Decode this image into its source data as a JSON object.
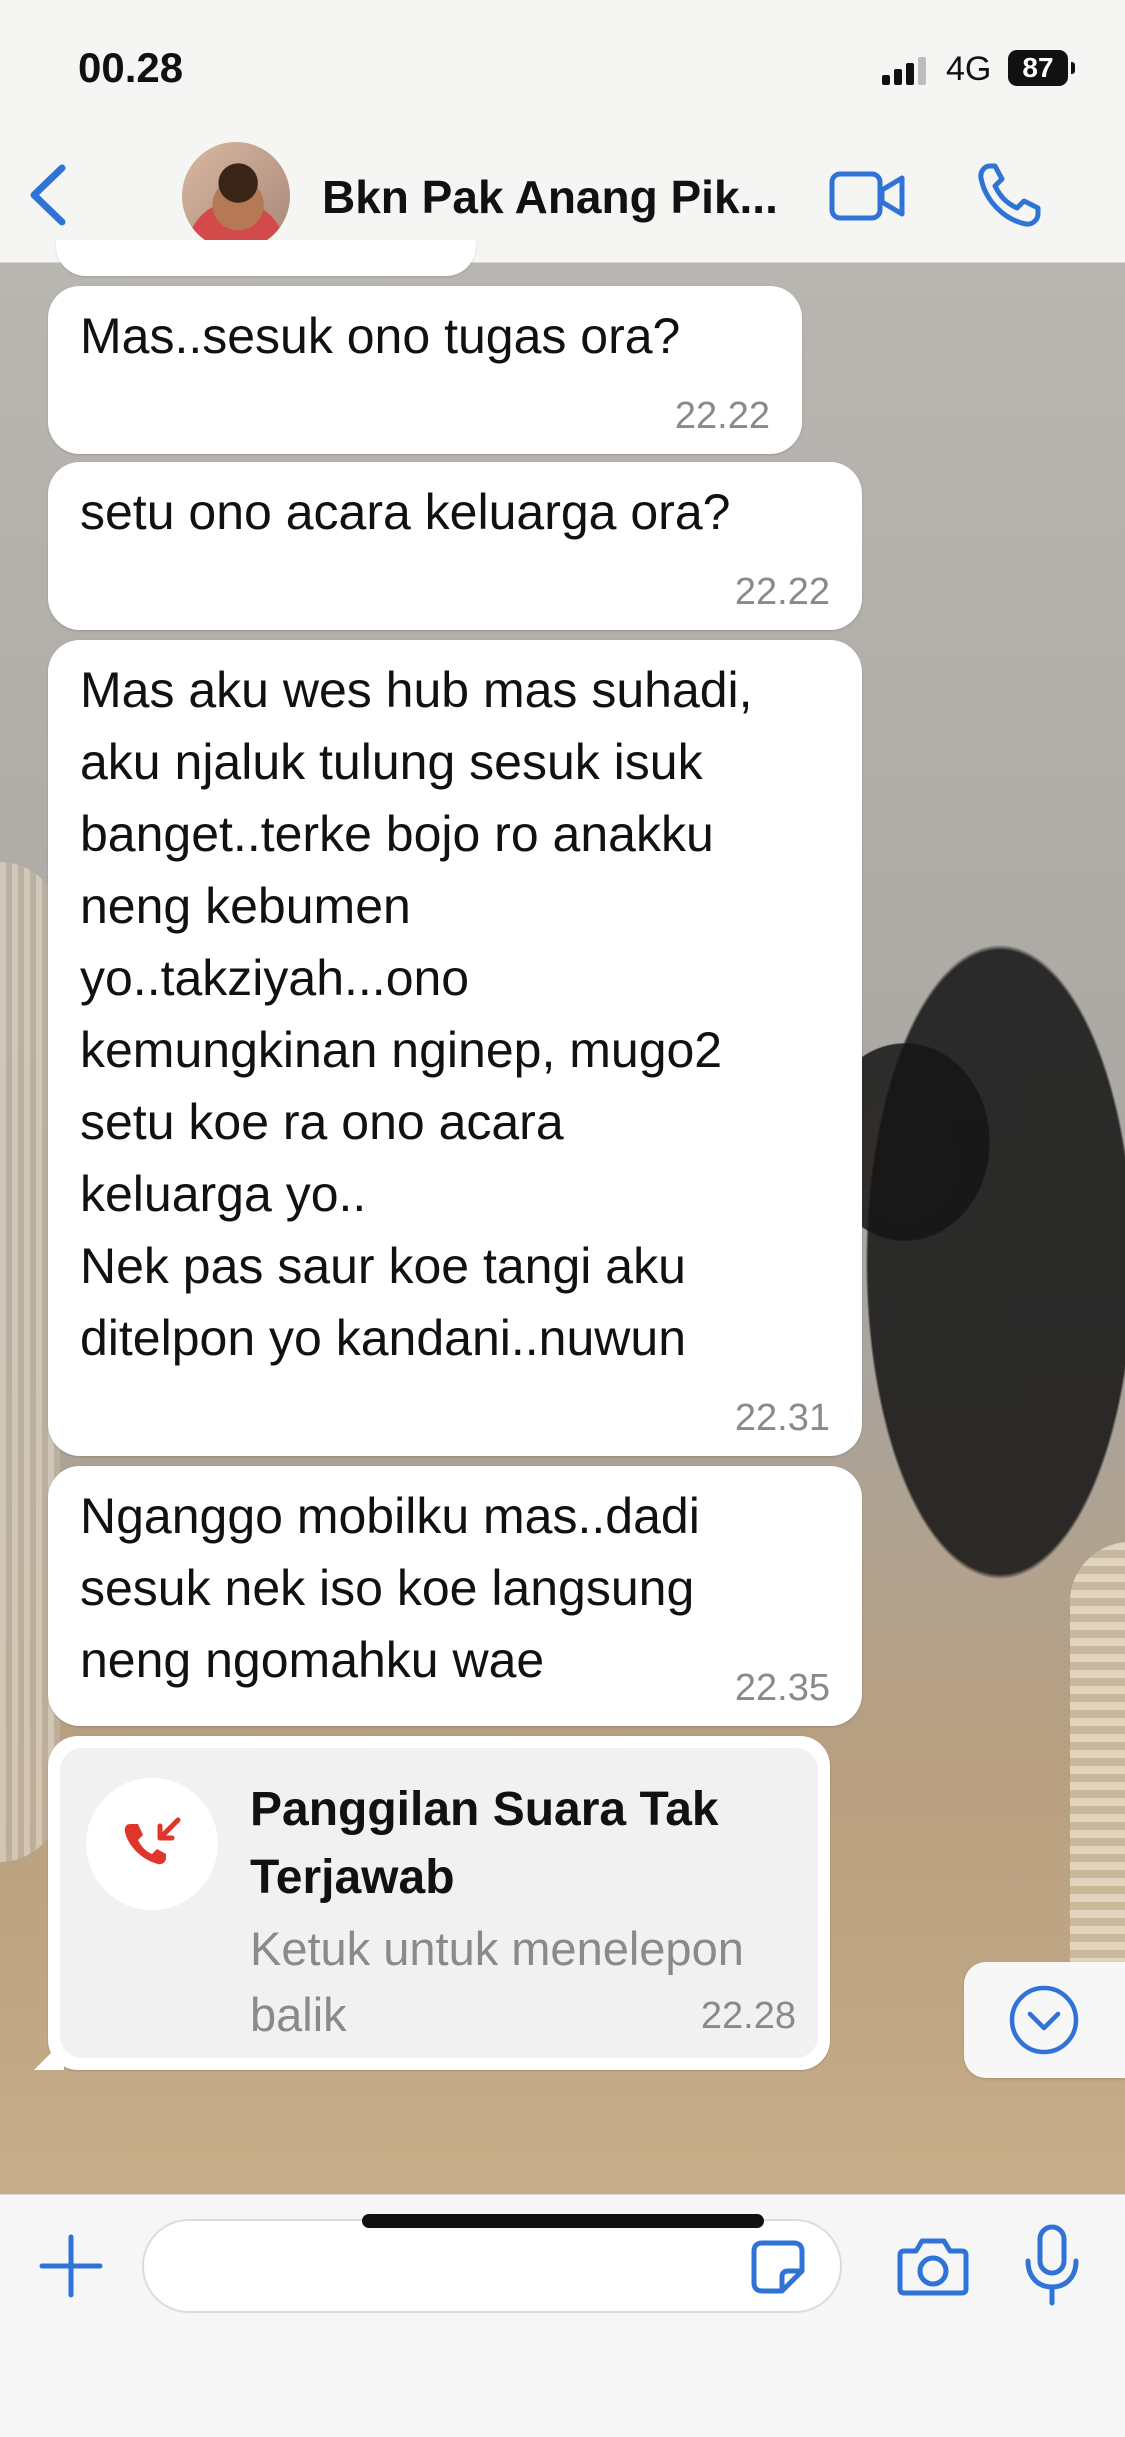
{
  "status_bar": {
    "time": "00.28",
    "network": "4G",
    "battery": "87"
  },
  "header": {
    "contact_name": "Bkn Pak Anang Pik..."
  },
  "messages": [
    {
      "text": "Mas..sesuk ono tugas ora?",
      "time": "22.22"
    },
    {
      "text": "setu ono acara keluarga ora?",
      "time": "22.22"
    },
    {
      "text": "Mas aku wes hub mas suhadi,\naku njaluk tulung sesuk isuk\nbanget..terke bojo ro anakku\nneng kebumen\nyo..takziyah...ono\nkemungkinan nginep, mugo2\nsetu koe ra ono acara\nkeluarga yo..\nNek pas saur koe tangi aku\nditelpon yo kandani..nuwun",
      "time": "22.31"
    },
    {
      "text": "Nganggo mobilku mas..dadi\nsesuk nek iso koe langsung\nneng ngomahku wae",
      "time": "22.35"
    }
  ],
  "missed_call": {
    "title": "Panggilan Suara Tak Terjawab",
    "subtitle": "Ketuk untuk menelepon balik",
    "time": "22.28"
  },
  "composer": {
    "value": ""
  },
  "colors": {
    "accent": "#2f73d6",
    "missed": "#e0352b"
  }
}
